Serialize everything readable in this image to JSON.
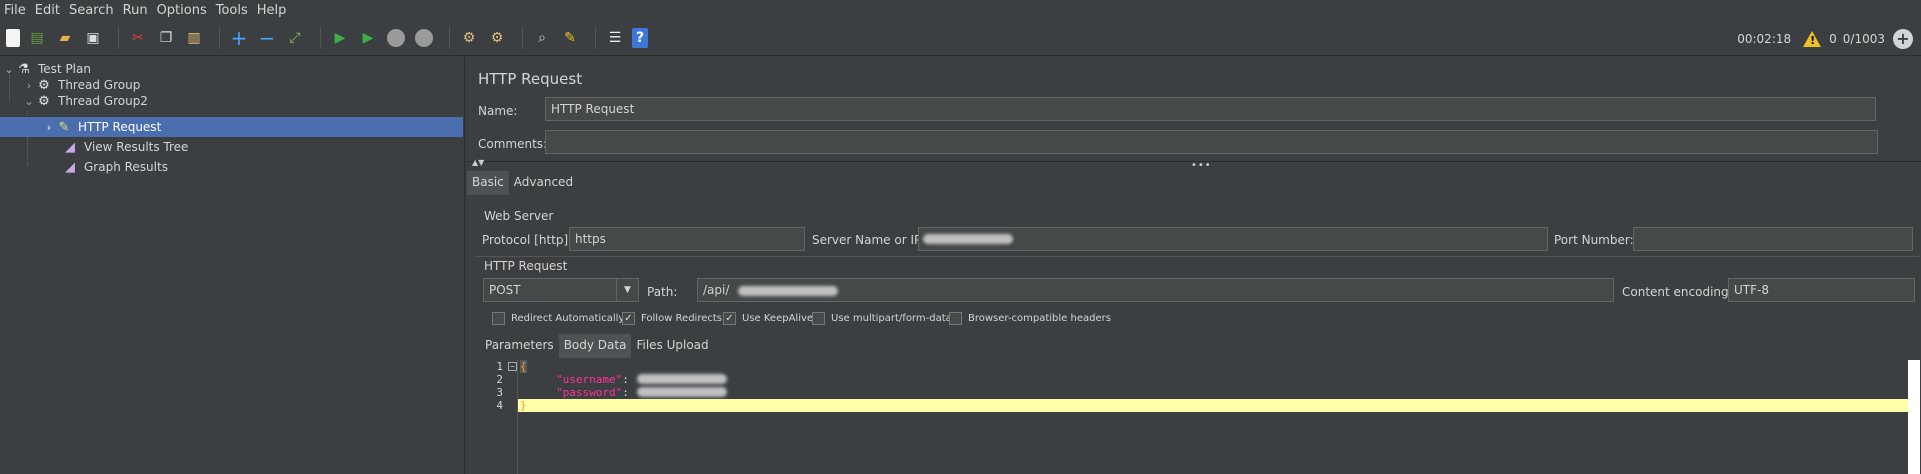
{
  "menu": [
    "File",
    "Edit",
    "Search",
    "Run",
    "Options",
    "Tools",
    "Help"
  ],
  "toolbar": {
    "buttons": [
      "new-icon",
      "templates-icon",
      "open-icon",
      "save-icon",
      "cut-icon",
      "copy-icon",
      "paste-icon",
      "expand-icon",
      "collapse-icon",
      "toggle-icon",
      "start-icon",
      "start-no-pause-icon",
      "stop-icon",
      "shutdown-icon",
      "clear-icon",
      "clear-all-icon",
      "search-icon",
      "reset-search-icon",
      "function-helper-icon",
      "help-icon"
    ],
    "elapsed": "00:02:18",
    "warnings": "0",
    "threads": "0/1003"
  },
  "tree": {
    "items": [
      {
        "label": "Test Plan",
        "icon": "flask-icon"
      },
      {
        "label": "Thread Group",
        "icon": "gear-icon"
      },
      {
        "label": "Thread Group2",
        "icon": "gear-icon"
      },
      {
        "label": "HTTP Request",
        "icon": "pipette-icon"
      },
      {
        "label": "View Results Tree",
        "icon": "chart-icon"
      },
      {
        "label": "Graph Results",
        "icon": "chart-icon"
      }
    ]
  },
  "panel": {
    "title": "HTTP Request",
    "name_label": "Name:",
    "name_value": "HTTP Request",
    "comments_label": "Comments:",
    "comments_value": "",
    "tabs": [
      "Basic",
      "Advanced"
    ],
    "web_server_label": "Web Server",
    "protocol_label": "Protocol [http]:",
    "protocol_value": "https",
    "server_label": "Server Name or IP:",
    "port_label": "Port Number:",
    "port_value": "",
    "http_request_label": "HTTP Request",
    "method": "POST",
    "path_label": "Path:",
    "path_value": "/api/",
    "encoding_label": "Content encoding:",
    "encoding_value": "UTF-8",
    "checkboxes": [
      {
        "label": "Redirect Automatically",
        "checked": false
      },
      {
        "label": "Follow Redirects",
        "checked": true
      },
      {
        "label": "Use KeepAlive",
        "checked": true
      },
      {
        "label": "Use multipart/form-data",
        "checked": false
      },
      {
        "label": "Browser-compatible headers",
        "checked": false
      }
    ],
    "subtabs": [
      "Parameters",
      "Body Data",
      "Files Upload"
    ],
    "body_lines": [
      {
        "num": "1",
        "text": "{"
      },
      {
        "num": "2",
        "key": "\"username\"",
        "sep": ":"
      },
      {
        "num": "3",
        "key": "\"password\"",
        "sep": ":"
      },
      {
        "num": "4",
        "text": "}"
      }
    ]
  }
}
